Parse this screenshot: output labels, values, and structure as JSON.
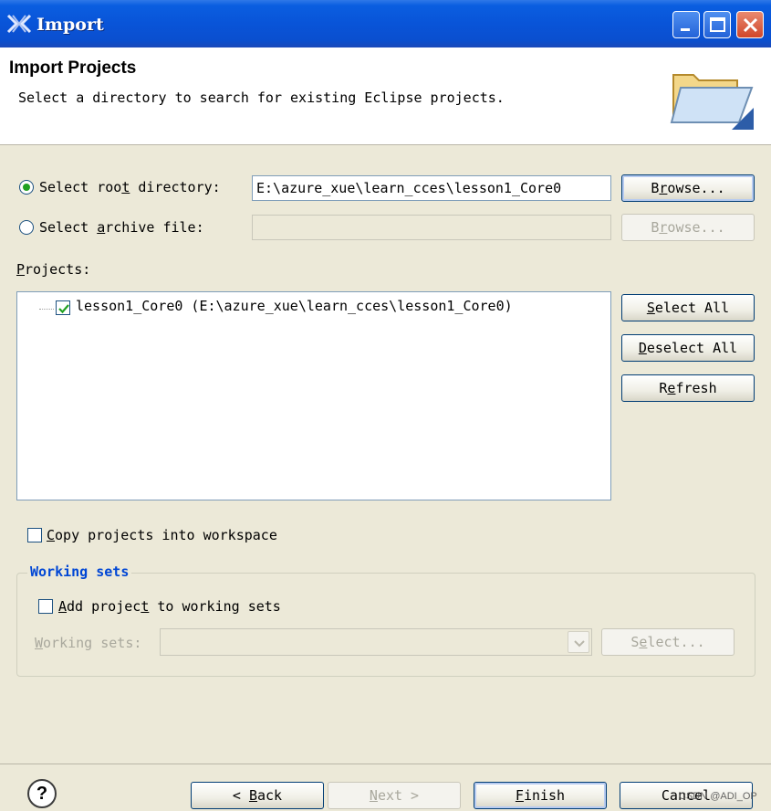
{
  "window": {
    "title": "Import"
  },
  "header": {
    "title": "Import Projects",
    "description": "Select a directory to search for existing Eclipse projects."
  },
  "source": {
    "root_dir_label_pre": "Select roo",
    "root_dir_label_mn": "t",
    "root_dir_label_post": " directory:",
    "root_dir_value": "E:\\azure_xue\\learn_cces\\lesson1_Core0",
    "root_dir_selected": true,
    "archive_label_pre": "Select ",
    "archive_label_mn": "a",
    "archive_label_post": "rchive file:",
    "archive_value": "",
    "browse_label_pre": "B",
    "browse_label_mn": "r",
    "browse_label_post": "owse..."
  },
  "projects": {
    "label_mn": "P",
    "label_post": "rojects:",
    "items": [
      {
        "label": "lesson1_Core0 (E:\\azure_xue\\learn_cces\\lesson1_Core0)",
        "checked": true
      }
    ],
    "select_all_mn": "S",
    "select_all_post": "elect All",
    "deselect_all_mn": "D",
    "deselect_all_post": "eselect All",
    "refresh_pre": "R",
    "refresh_mn": "e",
    "refresh_post": "fresh"
  },
  "copy_projects": {
    "label_mn": "C",
    "label_post": "opy projects into workspace",
    "checked": false
  },
  "working_sets": {
    "group_title": "Working sets",
    "add_label_mn": "A",
    "add_label_mid": "dd projec",
    "add_label_mn2": "t",
    "add_label_post": " to working sets",
    "add_checked": false,
    "sets_label_mn": "W",
    "sets_label_post": "orking sets:",
    "select_pre": "S",
    "select_mn": "e",
    "select_post": "lect..."
  },
  "footer": {
    "help": "?",
    "back_prefix": "< ",
    "back_mn": "B",
    "back_post": "ack",
    "next_mn": "N",
    "next_post": "ext >",
    "finish_mn": "F",
    "finish_post": "inish",
    "cancel": "Cancel",
    "watermark": "CSDN @ADI_OP"
  },
  "colors": {
    "titlebar": "#0a5ee0",
    "dialog_bg": "#ece9d8",
    "group_title": "#0046d5",
    "radio_dot": "#21a121"
  }
}
